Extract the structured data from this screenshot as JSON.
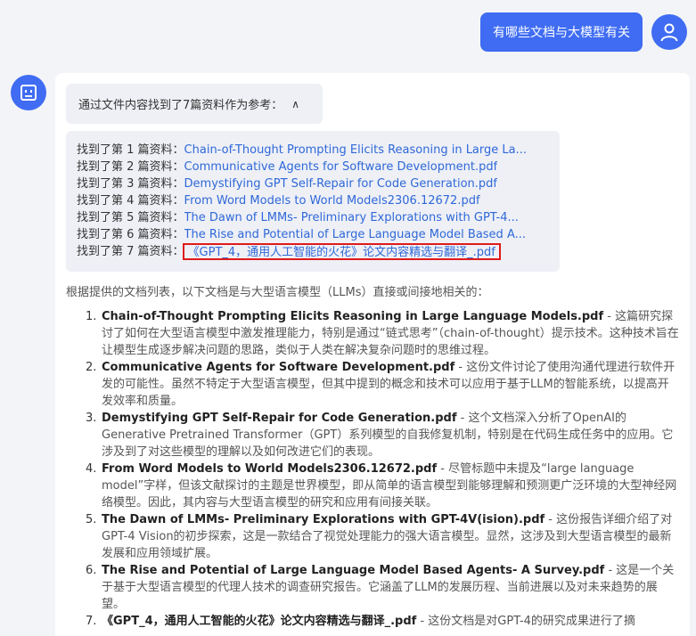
{
  "user_message": "有哪些文档与大模型有关",
  "references_toggle": {
    "label": "通过文件内容找到了7篇资料作为参考：",
    "chevron": "∧"
  },
  "references": [
    {
      "prefix": "找到了第 1 篇资料：",
      "title": "Chain-of-Thought Prompting Elicits Reasoning in Large La..."
    },
    {
      "prefix": "找到了第 2 篇资料：",
      "title": "Communicative Agents for Software Development.pdf"
    },
    {
      "prefix": "找到了第 3 篇资料：",
      "title": "Demystifying GPT Self-Repair for Code Generation.pdf"
    },
    {
      "prefix": "找到了第 4 篇资料：",
      "title": "From Word Models to World Models2306.12672.pdf"
    },
    {
      "prefix": "找到了第 5 篇资料：",
      "title": "The Dawn of LMMs- Preliminary Explorations with GPT-4..."
    },
    {
      "prefix": "找到了第 6 篇资料：",
      "title": "The Rise and Potential of Large Language Model Based A..."
    },
    {
      "prefix": "找到了第 7 篇资料：",
      "title": "《GPT_4，通用人工智能的火花》论文内容精选与翻译_.pdf"
    }
  ],
  "answer_intro": "根据提供的文档列表，以下文档是与大型语言模型（LLMs）直接或间接地相关的：",
  "answers": [
    {
      "num": "1.",
      "title": "Chain-of-Thought Prompting Elicits Reasoning in Large Language Models.pdf",
      "desc": " - 这篇研究探讨了如何在大型语言模型中激发推理能力，特别是通过“链式思考”（chain-of-thought）提示技术。这种技术旨在让模型生成逐步解决问题的思路，类似于人类在解决复杂问题时的思维过程。"
    },
    {
      "num": "2.",
      "title": "Communicative Agents for Software Development.pdf",
      "desc": " - 这份文件讨论了使用沟通代理进行软件开发的可能性。虽然不特定于大型语言模型，但其中提到的概念和技术可以应用于基于LLM的智能系统，以提高开发效率和质量。"
    },
    {
      "num": "3.",
      "title": "Demystifying GPT Self-Repair for Code Generation.pdf",
      "desc": " - 这个文档深入分析了OpenAI的Generative Pretrained Transformer（GPT）系列模型的自我修复机制，特别是在代码生成任务中的应用。它涉及到了对这些模型的理解以及如何改进它们的表现。"
    },
    {
      "num": "4.",
      "title": "From Word Models to World Models2306.12672.pdf",
      "desc": " - 尽管标题中未提及“large language model”字样，但该文献探讨的主题是世界模型，即从简单的语言模型到能够理解和预测更广泛环境的大型神经网络模型。因此，其内容与大型语言模型的研究和应用有间接关联。"
    },
    {
      "num": "5.",
      "title": "The Dawn of LMMs- Preliminary Explorations with GPT-4V(ision).pdf",
      "desc": " - 这份报告详细介绍了对GPT-4 Vision的初步探索，这是一款结合了视觉处理能力的强大语言模型。显然，这涉及到大型语言模型的最新发展和应用领域扩展。"
    },
    {
      "num": "6.",
      "title": "The Rise and Potential of Large Language Model Based Agents- A Survey.pdf",
      "desc": " - 这是一个关于基于大型语言模型的代理人技术的调查研究报告。它涵盖了LLM的发展历程、当前进展以及对未来趋势的展望。"
    },
    {
      "num": "7.",
      "title": "《GPT_4，通用人工智能的火花》论文内容精选与翻译_.pdf",
      "desc": " - 这份文档是对GPT-4的研究成果进行了摘"
    }
  ]
}
